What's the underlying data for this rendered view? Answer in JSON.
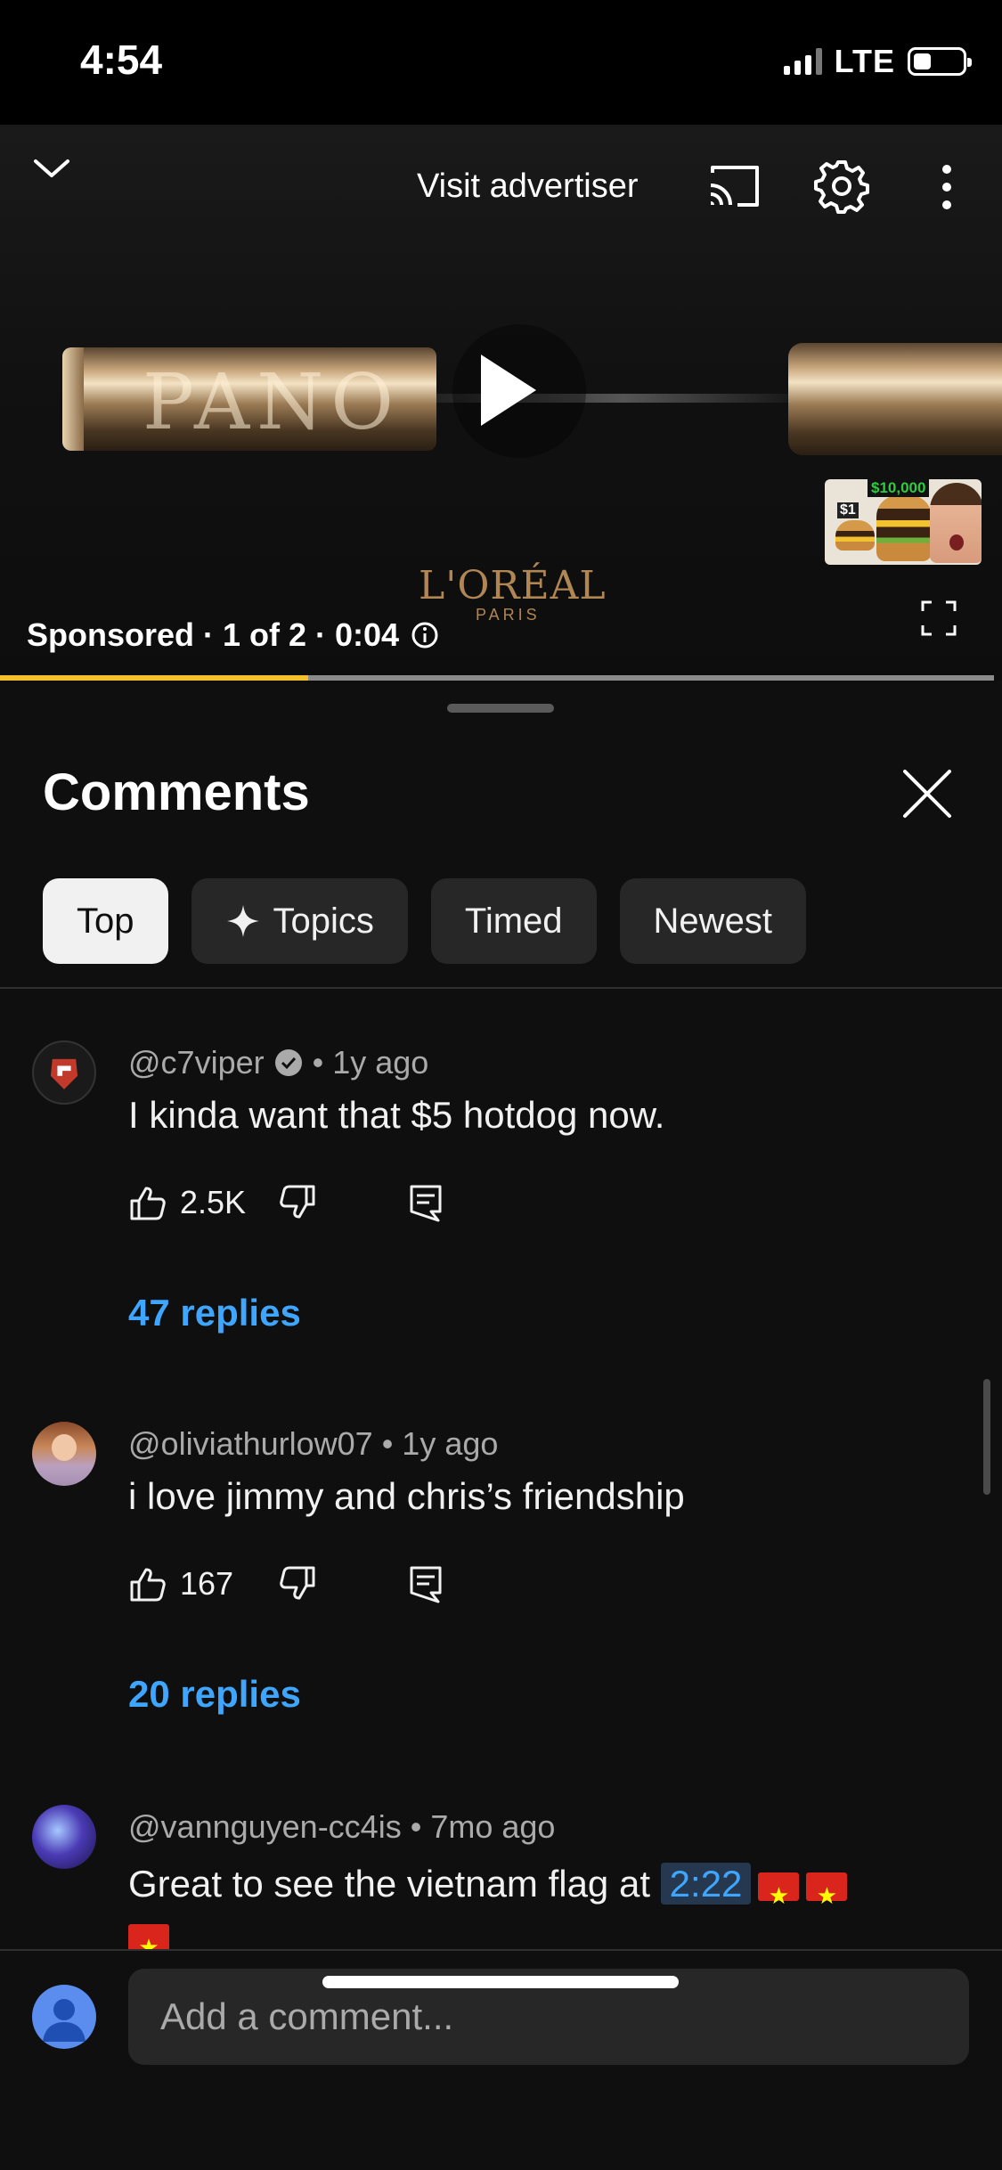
{
  "status_bar": {
    "time": "4:54",
    "network": "LTE",
    "battery_level": 0.35
  },
  "player": {
    "visit_advertiser": "Visit advertiser",
    "sponsored_info": "Sponsored · 1 of 2 · 0:04",
    "brand": "L'ORÉAL",
    "brand_sub": "PARIS",
    "product_text": "PANO",
    "thumbnail": {
      "price_top": "$10,000",
      "price_small": "$1"
    },
    "progress": 0.31
  },
  "comments": {
    "title": "Comments",
    "chips": [
      {
        "label": "Top",
        "active": true
      },
      {
        "label": "Topics",
        "active": false
      },
      {
        "label": "Timed",
        "active": false
      },
      {
        "label": "Newest",
        "active": false
      }
    ],
    "items": [
      {
        "author": "@c7viper",
        "verified": true,
        "sep": "•",
        "age": "1y ago",
        "text": "I kinda want that $5 hotdog now.",
        "likes": "2.5K",
        "replies": "47 replies"
      },
      {
        "author": "@oliviathurlow07",
        "verified": false,
        "sep": "•",
        "age": "1y ago",
        "text": "i love jimmy and chris’s friendship",
        "likes": "167",
        "replies": "20 replies"
      },
      {
        "author": "@vannguyen-cc4is",
        "verified": false,
        "sep": "•",
        "age": "7mo ago",
        "text_before": "Great to see the vietnam flag at",
        "timestamp": "2:22",
        "flags": [
          "🇻🇳",
          "🇻🇳",
          "🇻🇳"
        ]
      }
    ],
    "composer_placeholder": "Add a comment..."
  },
  "colors": {
    "background": "#0f0f0f",
    "link_blue": "#3ea6ff",
    "chip_bg": "#272727",
    "progress_yellow": "#f2c02a"
  }
}
